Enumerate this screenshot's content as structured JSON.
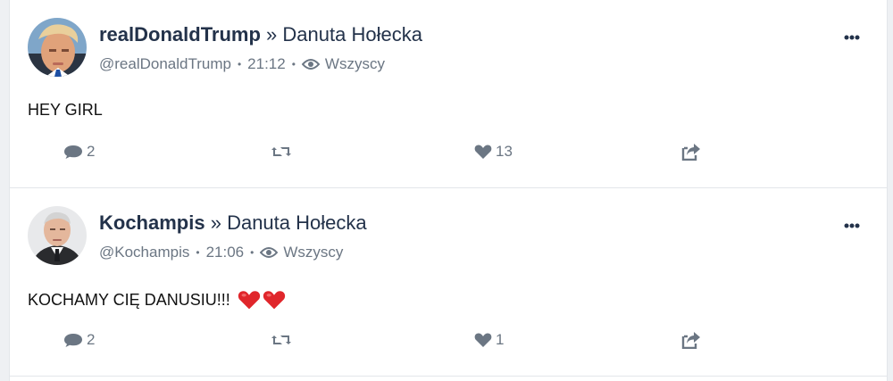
{
  "posts": [
    {
      "author": "realDonaldTrump",
      "target": "» Danuta Hołecka",
      "handle": "@realDonaldTrump",
      "time": "21:12",
      "visibility": "Wszyscy",
      "text": "HEY GIRL",
      "emoji": [],
      "replies": "2",
      "favourites": "13"
    },
    {
      "author": "Kochampis",
      "target": "» Danuta Hołecka",
      "handle": "@Kochampis",
      "time": "21:06",
      "visibility": "Wszyscy",
      "text": "KOCHAMY CIĘ DANUSIU!!!",
      "emoji": [
        "heart-emoji",
        "heart-emoji"
      ],
      "replies": "2",
      "favourites": "1"
    }
  ],
  "icons": {
    "more": "more-icon",
    "visibility": "eye-icon",
    "reply": "comment-icon",
    "boost": "retweet-icon",
    "favourite": "heart-icon",
    "share": "share-icon"
  },
  "colors": {
    "name": "#23324a",
    "meta": "#6b7683",
    "heart_emoji": "#e0262b"
  }
}
